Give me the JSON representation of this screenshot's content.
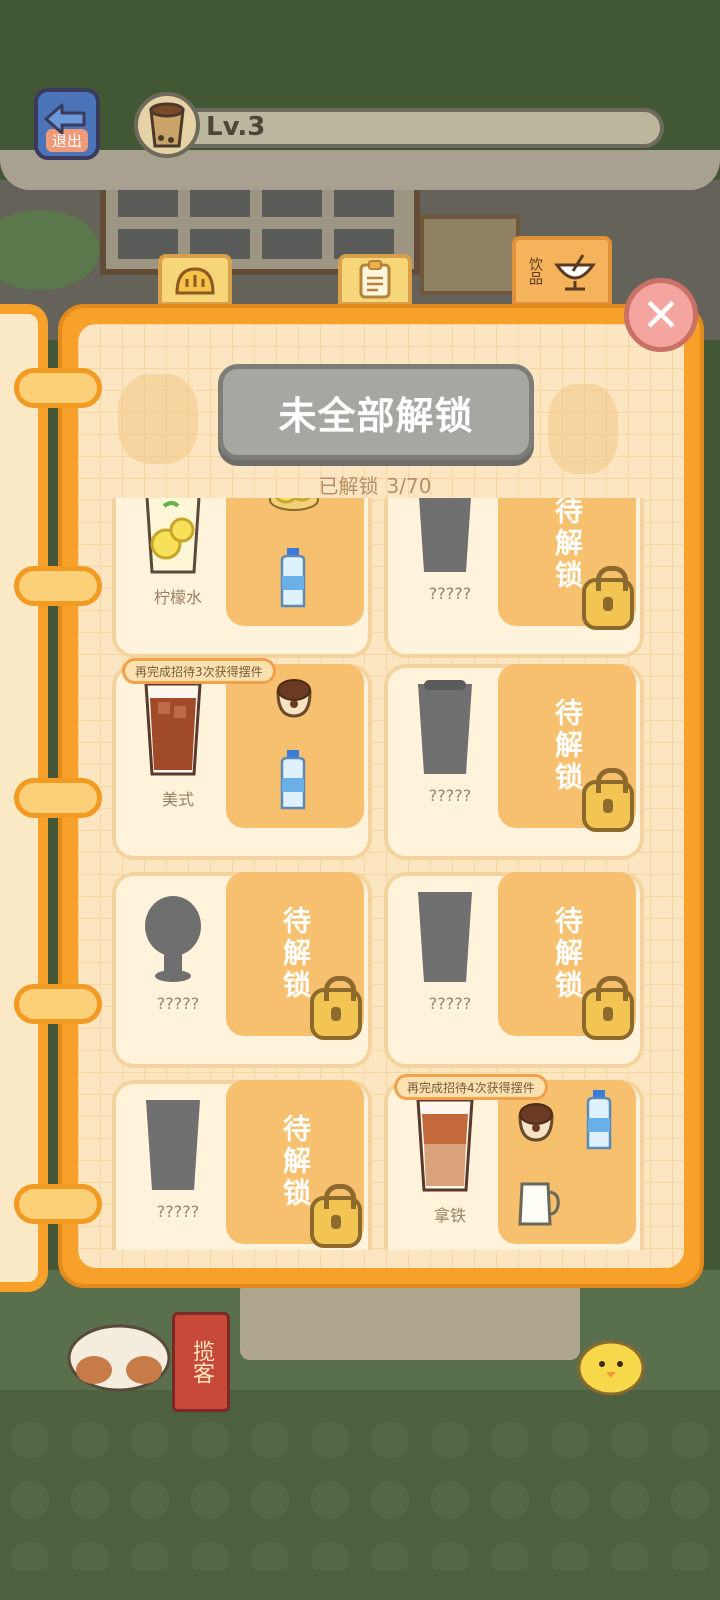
{
  "header": {
    "exit_label": "退出",
    "level_label": "Lv.3",
    "level_progress": 0.02
  },
  "tabs": [
    {
      "name": "bread-tab",
      "icon": "bread-icon"
    },
    {
      "name": "recipe-list-tab",
      "icon": "clipboard-icon"
    },
    {
      "name": "drinks-tab",
      "label": "饮品",
      "icon": "drink-icon",
      "active": true
    }
  ],
  "book": {
    "status_title": "未全部解锁",
    "progress_label": "已解锁",
    "progress_value": "3/70"
  },
  "drinks": [
    {
      "name": "柠檬水",
      "unlocked": true,
      "ingredients": [
        "lemon-slices-icon",
        "water-bottle-icon"
      ]
    },
    {
      "name": "?????",
      "unlocked": false,
      "pending_label": "待解锁"
    },
    {
      "name": "美式",
      "unlocked": true,
      "hint": "再完成招待3次获得摆件",
      "ingredients": [
        "coffee-beans-icon",
        "water-bottle-icon"
      ]
    },
    {
      "name": "?????",
      "unlocked": false,
      "pending_label": "待解锁"
    },
    {
      "name": "?????",
      "unlocked": false,
      "pending_label": "待解锁"
    },
    {
      "name": "?????",
      "unlocked": false,
      "pending_label": "待解锁"
    },
    {
      "name": "?????",
      "unlocked": false,
      "pending_label": "待解锁"
    },
    {
      "name": "拿铁",
      "unlocked": true,
      "hint": "再完成招待4次获得摆件",
      "ingredients": [
        "coffee-beans-icon",
        "water-bottle-icon",
        "milk-jug-icon"
      ]
    }
  ],
  "background": {
    "sign_text": "揽客"
  },
  "colors": {
    "book_border": "#f7a12a",
    "banner_locked": "#a7a7a1",
    "slot": "#f7c06e",
    "close": "#f4a5a0"
  }
}
